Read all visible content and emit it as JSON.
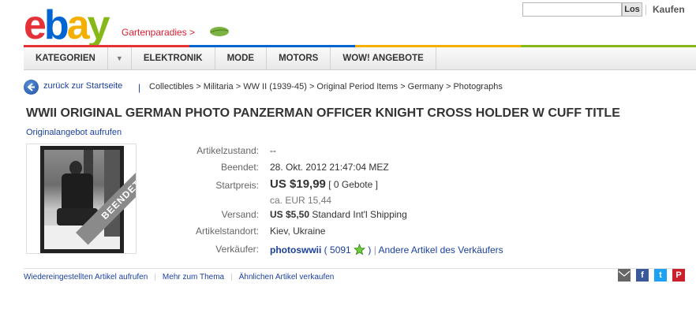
{
  "header": {
    "logo_letters": [
      "e",
      "b",
      "a",
      "y"
    ],
    "store_link": "Gartenparadies >",
    "search_placeholder": "",
    "search_button": "Los",
    "buy_link": "Kaufen",
    "brand_colors": {
      "red": "#e53238",
      "blue": "#0064d2",
      "yellow": "#f5af02",
      "green": "#86b817"
    }
  },
  "nav": {
    "items": [
      "KATEGORIEN",
      "ELEKTRONIK",
      "MODE",
      "MOTORS",
      "WOW! ANGEBOTE"
    ]
  },
  "breadcrumb": {
    "back_label": "zurück zur Startseite",
    "separator": "|",
    "path": "Collectibles > Militaria > WW II (1939-45) > Original Period Items > Germany > Photographs"
  },
  "listing": {
    "title": "WWII ORIGINAL GERMAN PHOTO PANZERMAN OFFICER KNIGHT CROSS HOLDER W CUFF TITLE",
    "original_link": "Originalangebot aufrufen",
    "image_banner": "BEENDET",
    "fields": {
      "condition_label": "Artikelzustand:",
      "condition_value": "--",
      "ended_label": "Beendet:",
      "ended_value": "28. Okt. 2012 21:47:04 MEZ",
      "start_price_label": "Startpreis:",
      "start_price_value": "US $19,99",
      "bids": "[ 0 Gebote ]",
      "approx_price": "ca. EUR 15,44",
      "shipping_label": "Versand:",
      "shipping_value": "US $5,50",
      "shipping_method": "Standard Int'l Shipping",
      "location_label": "Artikelstandort:",
      "location_value": "Kiev, Ukraine",
      "seller_label": "Verkäufer:",
      "seller_name": "photoswwii",
      "feedback_open": "(",
      "feedback_score": "5091",
      "feedback_close": ")",
      "sep": "|",
      "other_items": "Andere Artikel des Verkäufers"
    }
  },
  "footer": {
    "links": [
      "Wiedereingestellten Artikel aufrufen",
      "Mehr zum Thema",
      "Ähnlichen Artikel verkaufen"
    ],
    "share_icons": [
      "mail-icon",
      "facebook-icon",
      "twitter-icon",
      "pinterest-icon"
    ]
  }
}
